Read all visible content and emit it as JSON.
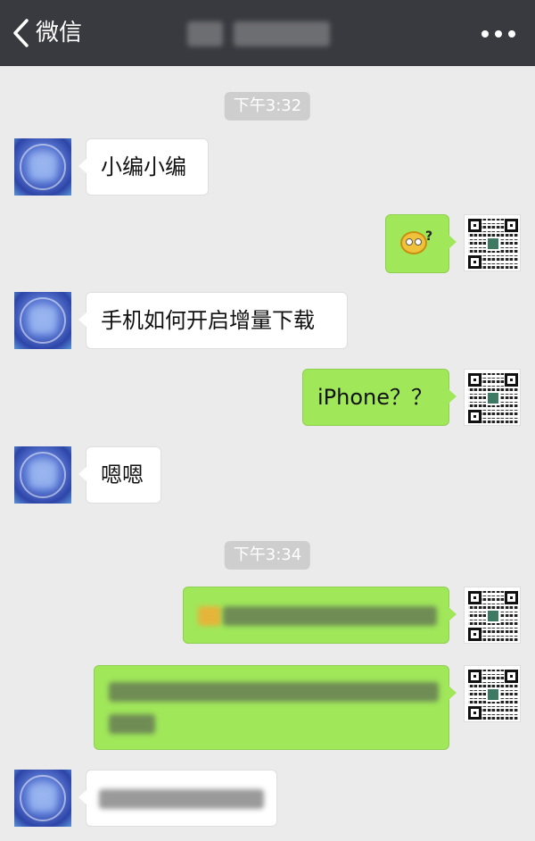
{
  "header": {
    "back_label": "微信",
    "back_icon": "chevron-left-icon",
    "more_icon": "more-dots-icon"
  },
  "timestamps": [
    "下午3:32",
    "下午3:34"
  ],
  "messages": [
    {
      "side": "left",
      "text": "小编小编"
    },
    {
      "side": "right",
      "emoji": "confused-face-emoji"
    },
    {
      "side": "left",
      "text": "手机如何开启增量下载"
    },
    {
      "side": "right",
      "text": "iPhone？？"
    },
    {
      "side": "left",
      "text": "嗯嗯"
    }
  ],
  "colors": {
    "titlebar": "#393a3f",
    "background": "#ebebeb",
    "sent_bubble": "#a0e75a",
    "received_bubble": "#ffffff",
    "timestamp_bg": "#cecece"
  }
}
